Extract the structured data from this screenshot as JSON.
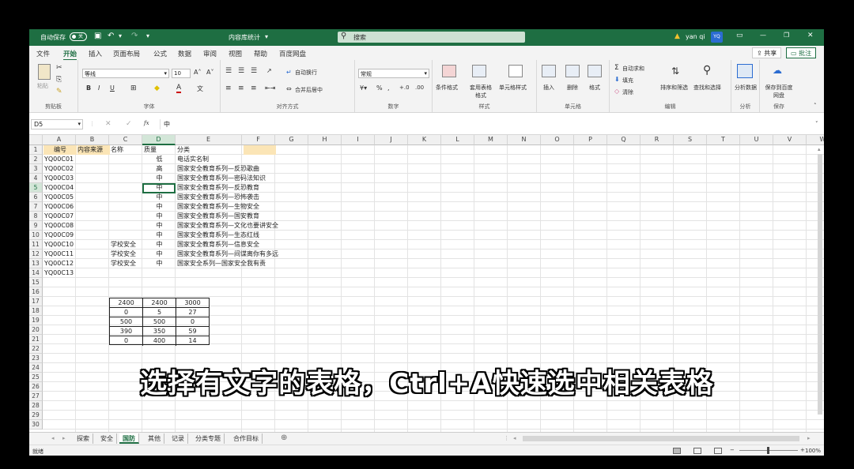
{
  "titlebar": {
    "autosave_label": "自动保存",
    "toggle_state": "关",
    "doc_title": "内容库统计",
    "search_placeholder": "搜索",
    "user_name": "yan qi",
    "user_initials": "YQ",
    "warning_icon": "warning-icon"
  },
  "menu": {
    "tabs": [
      "文件",
      "开始",
      "插入",
      "页面布局",
      "公式",
      "数据",
      "审阅",
      "视图",
      "帮助",
      "百度网盘"
    ],
    "active_tab": "开始",
    "share_label": "共享",
    "comment_label": "批注"
  },
  "ribbon": {
    "clipboard": {
      "label": "剪贴板",
      "paste": "粘贴"
    },
    "font": {
      "label": "字体",
      "font_name": "等线",
      "font_size": "10"
    },
    "alignment": {
      "label": "对齐方式",
      "wrap": "自动换行",
      "merge": "合并后居中"
    },
    "number": {
      "label": "数字",
      "format": "常规"
    },
    "styles": {
      "label": "样式",
      "conditional": "条件格式",
      "table": "套用表格格式",
      "cell": "单元格样式"
    },
    "cells": {
      "label": "单元格",
      "insert": "插入",
      "delete": "删除",
      "format": "格式"
    },
    "editing": {
      "label": "编辑",
      "autosum": "自动求和",
      "fill": "填充",
      "clear": "清除",
      "sort": "排序和筛选",
      "find": "查找和选择"
    },
    "analysis": {
      "label": "分析",
      "analyze": "分析数据"
    },
    "save": {
      "label": "保存",
      "save_to": "保存到百度网盘"
    }
  },
  "formula_bar": {
    "name_box": "D5",
    "fx": "fx",
    "value": "中"
  },
  "sheet": {
    "columns": [
      "A",
      "B",
      "C",
      "D",
      "E",
      "F",
      "G",
      "H",
      "I",
      "J",
      "K",
      "L",
      "M",
      "N",
      "O",
      "P",
      "Q",
      "R",
      "S",
      "T",
      "U",
      "V",
      "W"
    ],
    "selected_column": "D",
    "selected_row": 5,
    "rows": [
      "1",
      "2",
      "3",
      "4",
      "5",
      "6",
      "7",
      "8",
      "9",
      "10",
      "11",
      "12",
      "13",
      "14",
      "15",
      "16",
      "17",
      "18",
      "19",
      "20",
      "21",
      "22",
      "23",
      "24",
      "25",
      "26",
      "27",
      "28",
      "29",
      "30"
    ],
    "headers": {
      "a": "编号",
      "b": "内容来源",
      "c": "名称",
      "d": "质量",
      "e": "分类"
    },
    "data_rows": [
      {
        "a": "YQ00C01",
        "c": "",
        "d": "低",
        "e": "电话实名制"
      },
      {
        "a": "YQ00C02",
        "c": "",
        "d": "高",
        "e": "国家安全教育系列—反恐歌曲"
      },
      {
        "a": "YQ00C03",
        "c": "",
        "d": "中",
        "e": "国家安全教育系列—密码法知识"
      },
      {
        "a": "YQ00C04",
        "c": "",
        "d": "中",
        "e": "国家安全教育系列—反恐教育"
      },
      {
        "a": "YQ00C05",
        "c": "",
        "d": "中",
        "e": "国家安全教育系列—恐怖袭击"
      },
      {
        "a": "YQ00C06",
        "c": "",
        "d": "中",
        "e": "国家安全教育系列—生物安全"
      },
      {
        "a": "YQ00C07",
        "c": "",
        "d": "中",
        "e": "国家安全教育系列—国安教育"
      },
      {
        "a": "YQ00C08",
        "c": "",
        "d": "中",
        "e": "国家安全教育系列—文化也要讲安全"
      },
      {
        "a": "YQ00C09",
        "c": "",
        "d": "中",
        "e": "国家安全教育系列—生态红线"
      },
      {
        "a": "YQ00C10",
        "c": "学校安全",
        "d": "中",
        "e": "国家安全教育系列—信息安全"
      },
      {
        "a": "YQ00C11",
        "c": "学校安全",
        "d": "中",
        "e": "国家安全教育系列—间谍离你有多远"
      },
      {
        "a": "YQ00C12",
        "c": "学校安全",
        "d": "中",
        "e": "国家安全系列—国家安全我有责"
      },
      {
        "a": "YQ00C13",
        "c": "",
        "d": "",
        "e": ""
      }
    ],
    "small_table": [
      [
        "2400",
        "2400",
        "3000"
      ],
      [
        "0",
        "5",
        "27"
      ],
      [
        "500",
        "500",
        "0"
      ],
      [
        "390",
        "350",
        "59"
      ],
      [
        "0",
        "400",
        "14"
      ]
    ]
  },
  "sheet_tabs": [
    "探索",
    "安全",
    "国防",
    "其他",
    "记录",
    "分类专题",
    "合作目标"
  ],
  "active_sheet": "国防",
  "status": {
    "mode": "就绪",
    "zoom": "100%"
  },
  "subtitle": "选择有文字的表格，Ctrl+A快速选中相关表格"
}
